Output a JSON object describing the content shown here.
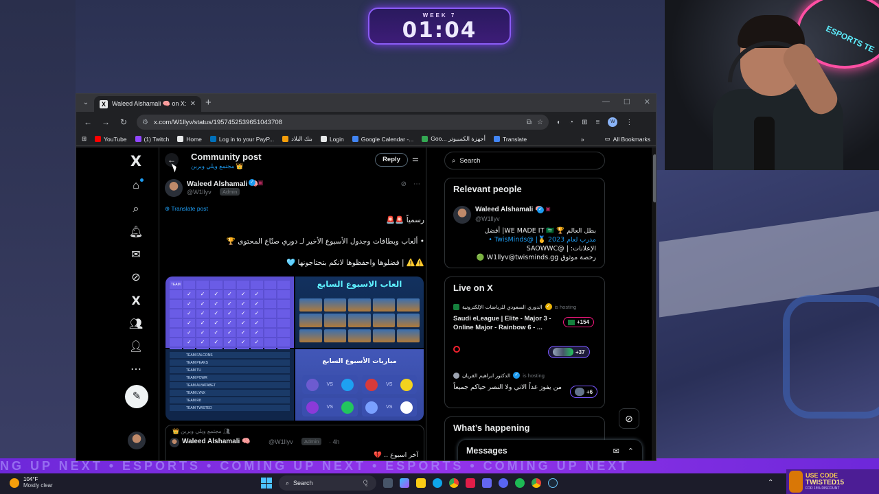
{
  "overlay": {
    "week_label": "WEEK 7",
    "timer": "01:04",
    "neon_text": "ESPORTS TE",
    "banner_text": "NG UP NEXT  •  ESPORTS  •  COMING UP NEXT  •  ESPORTS  •  COMING UP NEXT",
    "promo": {
      "line1": "USE CODE",
      "line2": "TWISTED15",
      "line3": "FOR 15% DISCOUNT"
    }
  },
  "browser": {
    "tab_title": "Waleed Alshamali 🧠 on X: \"رسم",
    "url": "x.com/W1llyv/status/1957452539651043708",
    "bookmarks": [
      {
        "label": "YouTube",
        "color": "#ff0000"
      },
      {
        "label": "(1) Twitch",
        "color": "#9146ff"
      },
      {
        "label": "Home",
        "color": "#e7e9ea"
      },
      {
        "label": "Log in to your PayP...",
        "color": "#0070ba"
      },
      {
        "label": "بنك البلاد",
        "color": "#f59e0b"
      },
      {
        "label": "Login",
        "color": "#e7e9ea"
      },
      {
        "label": "Google Calendar -...",
        "color": "#4285f4"
      },
      {
        "label": "Goo... أجهزة الكمبيوتر",
        "color": "#34a853"
      },
      {
        "label": "Translate",
        "color": "#4285f4"
      }
    ],
    "all_bookmarks": "All Bookmarks"
  },
  "x": {
    "header": {
      "title": "Community post",
      "community": "مجتمع ويلي وبربن 👑",
      "reply": "Reply"
    },
    "post": {
      "author": "Waleed Alshamali 🧠",
      "handle": "@W1llyv",
      "role": "Admin",
      "translate": "Translate post",
      "lines": [
        "رسمياً 🚨🚨",
        "• ألعاب وبطاقات وجدول الأسبوع الأخير لـ دوري صنّاع المحتوى 🏆",
        "⚠️⚠️ | فضلوها واحفظوها لانكم بتحتاجونها 🩵"
      ],
      "media": {
        "img2_title": "العاب الاسبوع السابع",
        "img4_title": "مباريات الأسبوع السابع",
        "img1_header": "TEAM",
        "standings": [
          "TEAM FALCONS",
          "TEAM PEAKS",
          "TEAM TU",
          "TEAM POWR",
          "TEAM ALBATABET",
          "TEAM LYNX",
          "TEAM R8",
          "TEAM TWISTED"
        ],
        "vs": "VS"
      }
    },
    "quoted": {
      "community": "مجتمع ويلي وبربن 👑",
      "author": "Waleed Alshamali 🧠",
      "handle": "@W1llyv",
      "role": "Admin",
      "time": "· 4h",
      "text": "آخر اسبوع .. 💔"
    },
    "right": {
      "search_placeholder": "Search",
      "relevant_title": "Relevant people",
      "rp_name": "Waleed Alshamali 🧠",
      "rp_handle": "@W1llyv",
      "rp_bio_1": "بطل العالم 🏆 WE MADE IT 🇸🇦| أفضل",
      "rp_bio_2": "مدرب لعام 2023 🥇| @TwisMinds •",
      "rp_bio_3": "الإعلانات: | @SAOWWC",
      "rp_bio_4": "رخصة موثوق W1llyv@twisminds.gg 🟢",
      "live_title": "Live on X",
      "space1_host": "الدوري السعودي للرياضات الإلكترونية",
      "space1_status": "is hosting",
      "space1_title": "Saudi eLeague | Elite - Major 3 - Online Major - Rainbow 6 - ...",
      "space1_count": "+154",
      "space2_count": "+37",
      "space3_host": "الدكتور ابراهيم القريان",
      "space3_status": "is hosting",
      "space3_title": "من يفوز غداً الاتي ولا النصر حياكم جميعاً",
      "space3_count": "+6",
      "happening_title": "What’s happening"
    },
    "messages": "Messages"
  },
  "taskbar": {
    "temp": "104°F",
    "weather": "Mostly clear",
    "search": "Search"
  }
}
